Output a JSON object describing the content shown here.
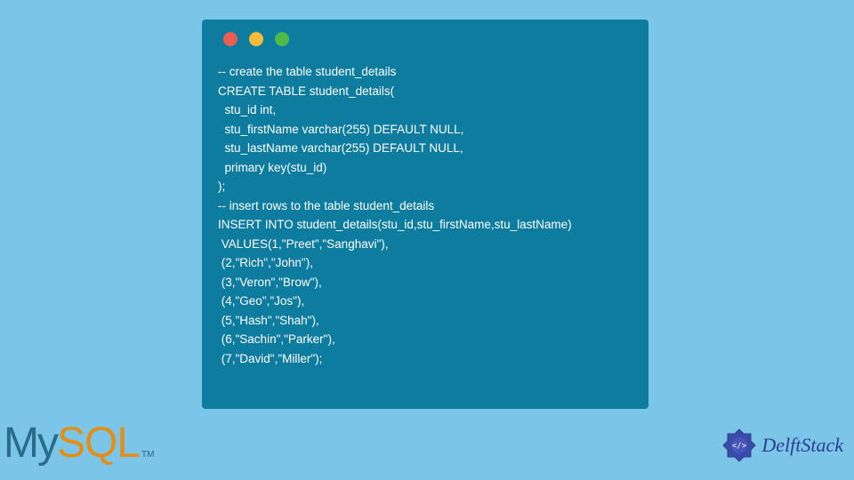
{
  "code": {
    "lines": [
      "-- create the table student_details",
      "CREATE TABLE student_details(",
      "  stu_id int,",
      "  stu_firstName varchar(255) DEFAULT NULL,",
      "  stu_lastName varchar(255) DEFAULT NULL,",
      "  primary key(stu_id)",
      ");",
      "-- insert rows to the table student_details",
      "INSERT INTO student_details(stu_id,stu_firstName,stu_lastName)",
      " VALUES(1,\"Preet\",\"Sanghavi\"),",
      " (2,\"Rich\",\"John\"),",
      " (3,\"Veron\",\"Brow\"),",
      " (4,\"Geo\",\"Jos\"),",
      " (5,\"Hash\",\"Shah\"),",
      " (6,\"Sachin\",\"Parker\"),",
      " (7,\"David\",\"Miller\");"
    ]
  },
  "logos": {
    "mysql_my": "My",
    "mysql_sql": "SQL",
    "mysql_tm": "TM",
    "delft": "DelftStack"
  }
}
